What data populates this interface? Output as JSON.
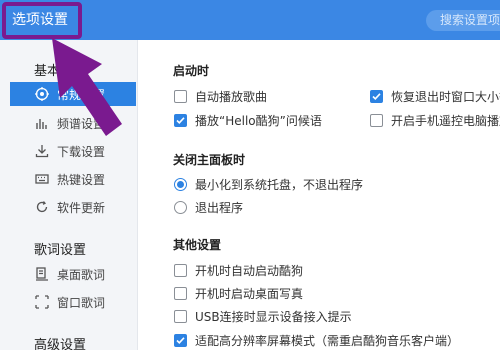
{
  "window": {
    "title": "选项设置",
    "search_placeholder": "搜索设置项"
  },
  "sidebar": {
    "sections": [
      {
        "title": "基本设置",
        "items": [
          {
            "label": "常规设置",
            "icon": "target-icon",
            "active": true
          },
          {
            "label": "频谱设置",
            "icon": "spectrum-icon"
          },
          {
            "label": "下载设置",
            "icon": "download-icon"
          },
          {
            "label": "热键设置",
            "icon": "keyboard-icon"
          },
          {
            "label": "软件更新",
            "icon": "update-icon"
          }
        ]
      },
      {
        "title": "歌词设置",
        "items": [
          {
            "label": "桌面歌词",
            "icon": "desktop-lyrics-icon"
          },
          {
            "label": "窗口歌词",
            "icon": "window-lyrics-icon"
          }
        ]
      },
      {
        "title": "高级设置",
        "items": []
      }
    ]
  },
  "main": {
    "startup": {
      "title": "启动时",
      "options": [
        {
          "label": "自动播放歌曲",
          "checked": false
        },
        {
          "label": "恢复退出时窗口大小等",
          "checked": true
        },
        {
          "label": "播放“Hello酷狗”问候语",
          "checked": true
        },
        {
          "label": "开启手机遥控电脑播放",
          "checked": false
        }
      ]
    },
    "close_panel": {
      "title": "关闭主面板时",
      "options": [
        {
          "label": "最小化到系统托盘，不退出程序",
          "selected": true
        },
        {
          "label": "退出程序",
          "selected": false
        }
      ]
    },
    "other": {
      "title": "其他设置",
      "options": [
        {
          "label": "开机时自动启动酷狗",
          "checked": false
        },
        {
          "label": "开机时启动桌面写真",
          "checked": false
        },
        {
          "label": "USB连接时显示设备接入提示",
          "checked": false
        },
        {
          "label": "适配高分辨率屏幕模式（需重启酷狗音乐客户端）",
          "checked": true
        }
      ]
    }
  },
  "colors": {
    "accent": "#2c82e2",
    "titlebar": "#3b87e4",
    "annotation": "#7a1a8f"
  }
}
